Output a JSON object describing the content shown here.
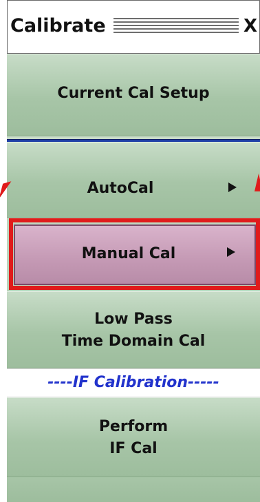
{
  "window": {
    "title": "Calibrate",
    "close_label": "X"
  },
  "menu": {
    "current_cal_setup": "Current Cal Setup",
    "autocal": "AutoCal",
    "manual_cal": "Manual Cal",
    "low_pass_line1": "Low Pass",
    "low_pass_line2": "Time Domain Cal",
    "if_section_header": "----IF Calibration-----",
    "perform_line1": "Perform",
    "perform_line2": "IF Cal"
  },
  "colors": {
    "menu_green": "#a7c5a7",
    "selected_mauve": "#c499b4",
    "highlight_red": "#e01b1b",
    "separator_blue": "#1f3fa6",
    "if_header_text": "#2233cc"
  },
  "icons": {
    "submenu_arrow": "right-triangle"
  }
}
